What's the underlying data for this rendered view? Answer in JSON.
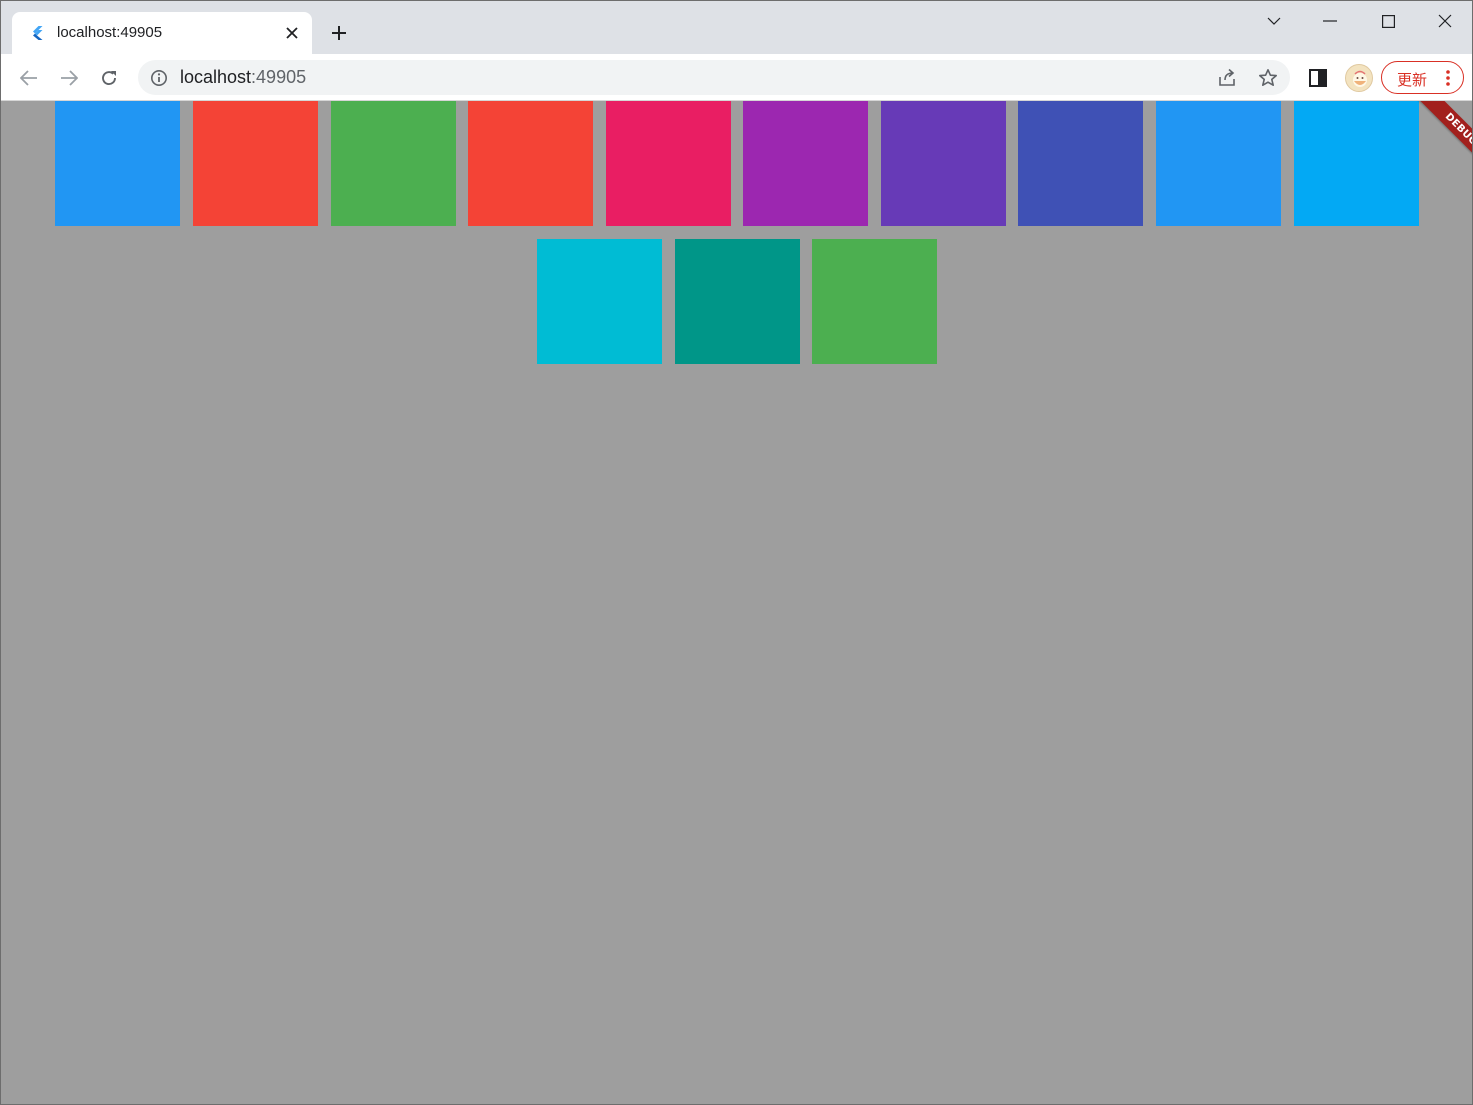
{
  "browser": {
    "tab": {
      "title": "localhost:49905",
      "favicon": "flutter-icon",
      "close_icon": "close-icon"
    },
    "new_tab_icon": "plus-icon",
    "window_controls": [
      "chevron-down-icon",
      "minimize-icon",
      "maximize-icon",
      "close-icon"
    ],
    "toolbar": {
      "back_icon": "arrow-left-icon",
      "forward_icon": "arrow-right-icon",
      "reload_icon": "reload-icon",
      "address": {
        "host": "localhost",
        "port": ":49905",
        "info_icon": "info-icon",
        "share_icon": "share-icon",
        "bookmark_icon": "star-icon"
      },
      "side_panel_icon": "side-panel-icon",
      "profile_icon": "avatar-icon",
      "update_button": {
        "label": "更新",
        "menu_icon": "more-vert-icon"
      }
    }
  },
  "app": {
    "background": "#9e9e9e",
    "tiles": [
      {
        "color": "#2196f3"
      },
      {
        "color": "#f44336"
      },
      {
        "color": "#4caf50"
      },
      {
        "color": "#f44336"
      },
      {
        "color": "#e91e63"
      },
      {
        "color": "#9c27b0"
      },
      {
        "color": "#673ab7"
      },
      {
        "color": "#3f51b5"
      },
      {
        "color": "#2196f3"
      },
      {
        "color": "#03a9f4"
      },
      {
        "color": "#00bcd4"
      },
      {
        "color": "#009688"
      },
      {
        "color": "#4caf50"
      }
    ],
    "debug_banner": "DEBUG"
  }
}
